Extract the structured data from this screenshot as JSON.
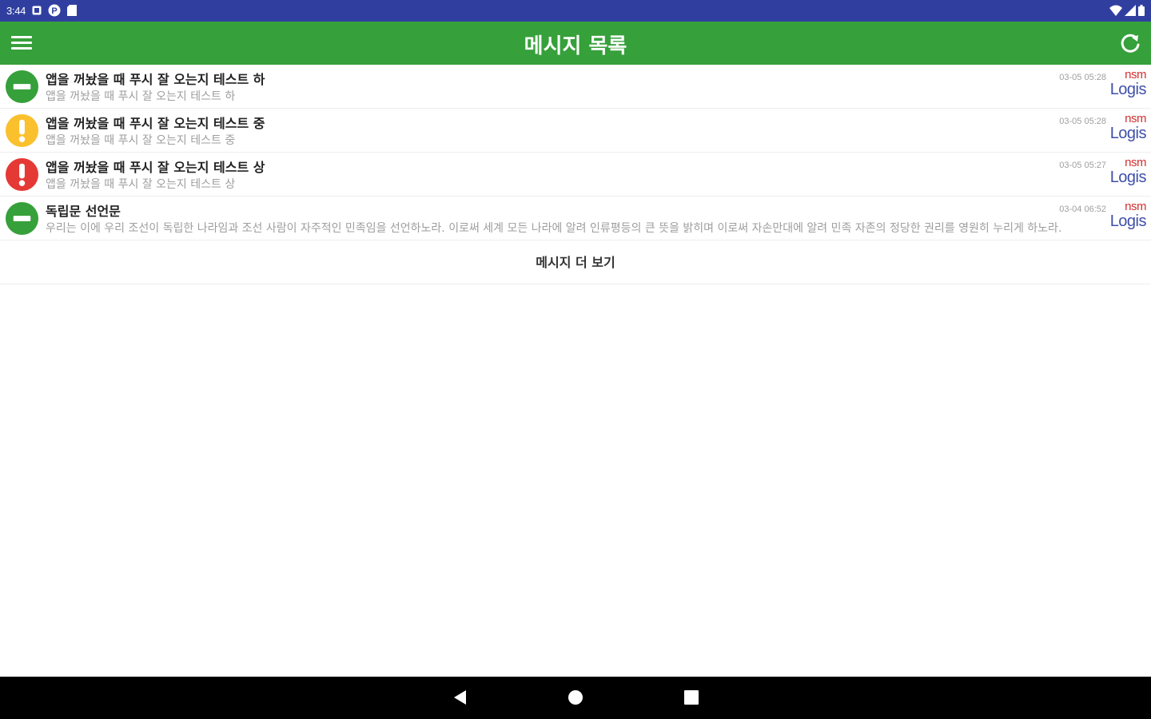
{
  "status_bar": {
    "time": "3:44",
    "left_icons": [
      "notification-square-icon",
      "p-circle-icon",
      "sd-card-icon"
    ],
    "right_icons": [
      "wifi-icon",
      "cell-signal-icon",
      "battery-icon"
    ]
  },
  "app_bar": {
    "title": "메시지 목록",
    "menu_icon": "hamburger-menu-icon",
    "refresh_icon": "refresh-icon",
    "color": "#36a03a"
  },
  "messages": [
    {
      "priority": "low",
      "icon": "minus-circle-icon",
      "icon_color": "#36a03a",
      "title": "앱을 꺼놨을 때 푸시 잘 오는지 테스트 하",
      "body": "앱을 꺼놨을 때 푸시 잘 오는지 테스트 하",
      "time": "03-05 05:28",
      "logo_top": "nsm",
      "logo_bottom": "Logis"
    },
    {
      "priority": "medium",
      "icon": "exclamation-circle-icon",
      "icon_color": "#fbc02d",
      "title": "앱을 꺼놨을 때 푸시 잘 오는지 테스트 중",
      "body": "앱을 꺼놨을 때 푸시 잘 오는지 테스트 중",
      "time": "03-05 05:28",
      "logo_top": "nsm",
      "logo_bottom": "Logis"
    },
    {
      "priority": "high",
      "icon": "exclamation-circle-icon",
      "icon_color": "#e53935",
      "title": "앱을 꺼놨을 때 푸시 잘 오는지 테스트 상",
      "body": "앱을 꺼놨을 때 푸시 잘 오는지 테스트 상",
      "time": "03-05 05:27",
      "logo_top": "nsm",
      "logo_bottom": "Logis"
    },
    {
      "priority": "low",
      "icon": "minus-circle-icon",
      "icon_color": "#36a03a",
      "title": "독립문 선언문",
      "body": "우리는 이에 우리 조선이 독립한 나라임과 조선 사람이 자주적인 민족임을 선언하노라. 이로써 세계 모든 나라에 알려 인류평등의 큰 뜻을 밝히며 이로써 자손만대에 알려 민족 자존의 정당한 권리를 영원히 누리게 하노라.",
      "time": "03-04 06:52",
      "logo_top": "nsm",
      "logo_bottom": "Logis"
    }
  ],
  "more_button_label": "메시지 더 보기",
  "nav_bar": {
    "buttons": [
      "back-icon",
      "home-icon",
      "recents-icon"
    ]
  }
}
